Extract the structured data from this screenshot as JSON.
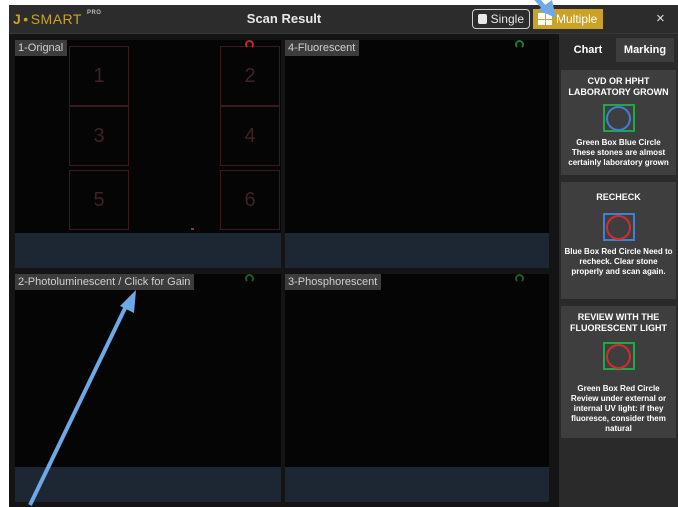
{
  "app": {
    "logo_brand": "J",
    "logo_dot": "•",
    "logo_name": "SMART",
    "logo_superscript": "PRO",
    "title": "Scan Result",
    "close_glyph": "×",
    "accent_color": "#c9a227"
  },
  "view_modes": {
    "single_label": "Single",
    "multiple_label": "Multiple",
    "selected": "Multiple"
  },
  "panels": {
    "original": {
      "label": "1-Orignal",
      "grid_numbers": [
        "1",
        "2",
        "3",
        "4",
        "5",
        "6"
      ]
    },
    "fluorescent": {
      "label": "4-Fluorescent"
    },
    "photoluminescent": {
      "label": "2-Photoluminescent / Click for Gain"
    },
    "phosphorescent": {
      "label": "3-Phosphorescent"
    }
  },
  "side_panel": {
    "tabs": [
      {
        "label": "Chart",
        "active": false
      },
      {
        "label": "Marking",
        "active": true
      }
    ],
    "legend": [
      {
        "title": "CVD OR HPHT LABORATORY GROWN",
        "box_color": "#22a64a",
        "circle_color": "#3f7fd4",
        "description": "Green Box Blue Circle These stones are almost certainly laboratory grown"
      },
      {
        "title": "RECHECK",
        "box_color": "#3f7fd4",
        "circle_color": "#d62b2b",
        "description": "Blue Box Red Circle Need to recheck. Clear stone properly and scan again."
      },
      {
        "title": "REVIEW WITH THE FLUORESCENT LIGHT",
        "box_color": "#22a64a",
        "circle_color": "#d62b2b",
        "description": "Green Box Red Circle Review under external or internal UV light: if they fluoresce, consider them natural"
      }
    ]
  }
}
